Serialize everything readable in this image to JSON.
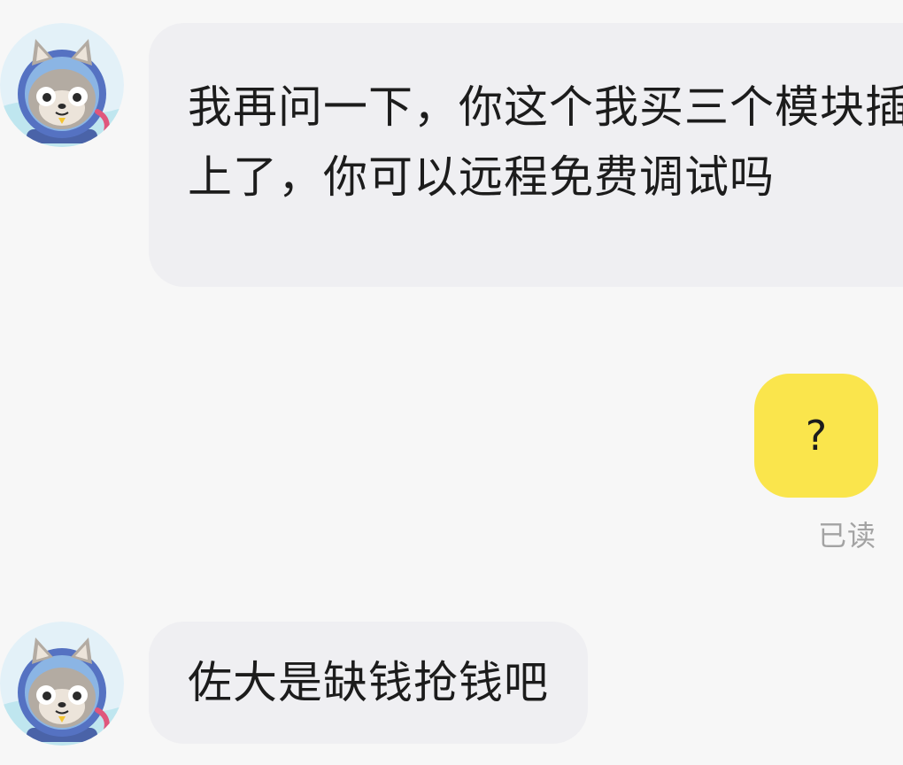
{
  "messages": [
    {
      "side": "incoming",
      "text": "我再问一下，你这个我买三个模块插上了，你可以远程免费调试吗"
    },
    {
      "side": "outgoing",
      "text": "?",
      "status": "已读"
    },
    {
      "side": "incoming",
      "text": "佐大是缺钱抢钱吧"
    }
  ],
  "avatar_icon": "cat-astronaut-icon",
  "colors": {
    "background": "#f7f7f7",
    "incoming_bubble": "#efeff2",
    "outgoing_bubble": "#fae54c",
    "status_text": "#a3a3a3"
  }
}
